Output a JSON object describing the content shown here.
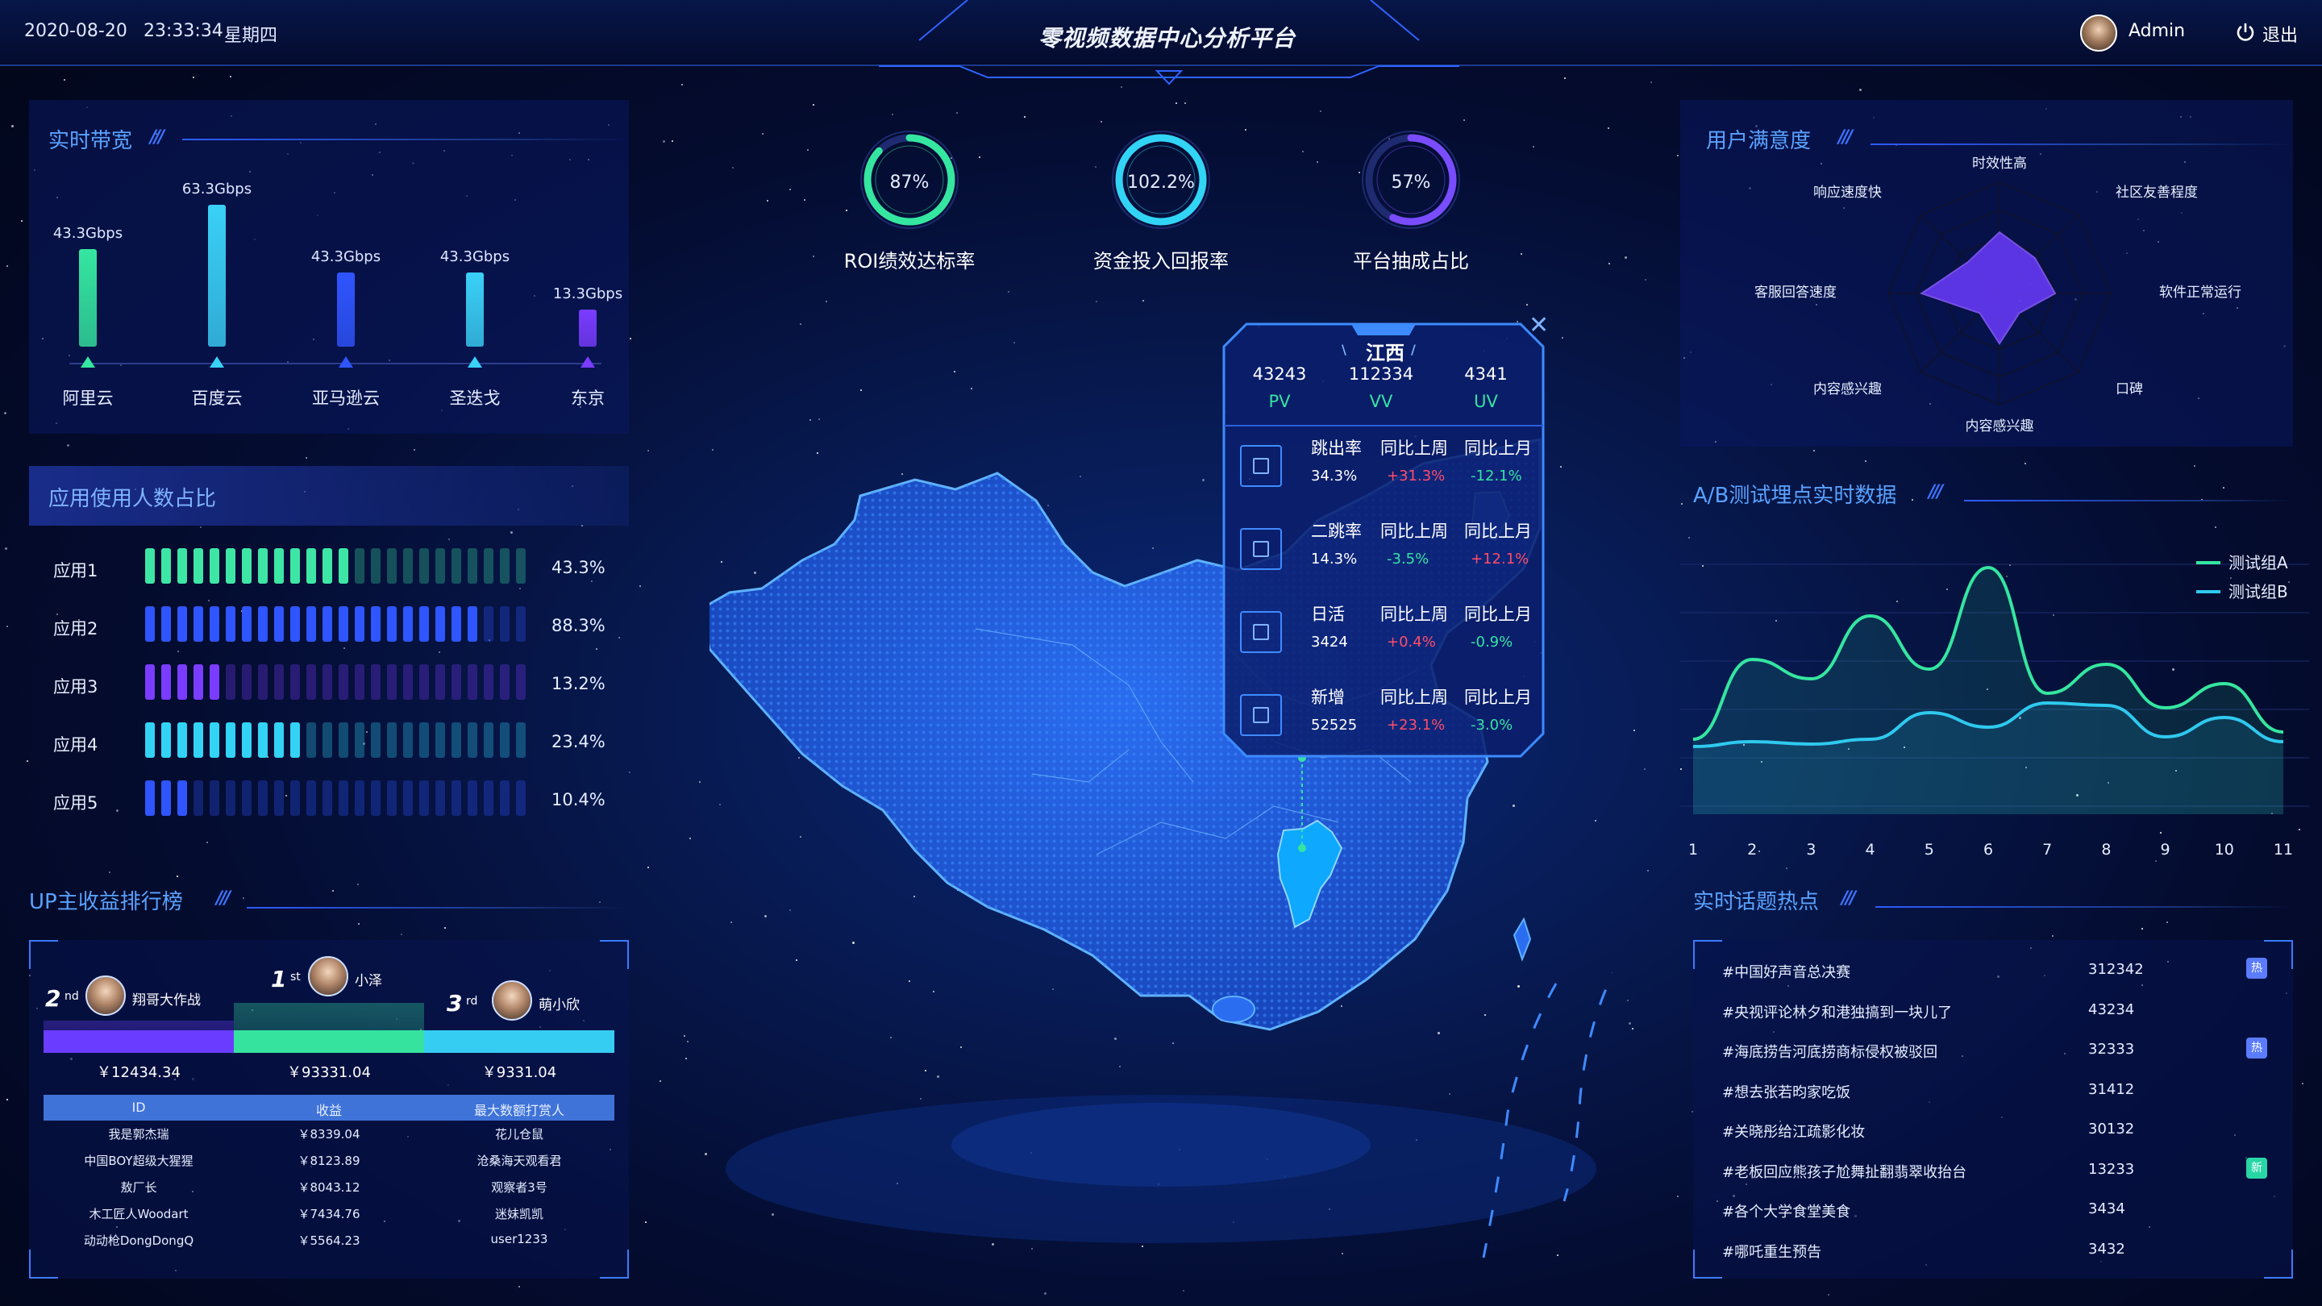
{
  "header": {
    "date": "2020-08-20",
    "time": "23:33:34",
    "weekday": "星期四",
    "title": "零视频数据中心分析平台",
    "user": "Admin",
    "logout": "退出"
  },
  "bandwidth": {
    "title": "实时带宽",
    "items": [
      {
        "label": "阿里云",
        "value": "43.3Gbps",
        "level": 0.69,
        "color": "#35e6a0"
      },
      {
        "label": "百度云",
        "value": "63.3Gbps",
        "level": 1.0,
        "color": "#3ad1f7"
      },
      {
        "label": "亚马逊云",
        "value": "43.3Gbps",
        "level": 0.52,
        "color": "#2f55ff"
      },
      {
        "label": "圣迭戈",
        "value": "43.3Gbps",
        "level": 0.52,
        "color": "#3ad1f7"
      },
      {
        "label": "东京",
        "value": "13.3Gbps",
        "level": 0.26,
        "color": "#7a3cff"
      }
    ]
  },
  "app_usage": {
    "title": "应用使用人数占比",
    "items": [
      {
        "label": "应用1",
        "pct": "43.3%",
        "on": 13,
        "color": "#3ee6a6"
      },
      {
        "label": "应用2",
        "pct": "88.3%",
        "on": 21,
        "color": "#2f55ff"
      },
      {
        "label": "应用3",
        "pct": "13.2%",
        "on": 5,
        "color": "#7a3cff"
      },
      {
        "label": "应用4",
        "pct": "23.4%",
        "on": 10,
        "color": "#33d3f5"
      },
      {
        "label": "应用5",
        "pct": "10.4%",
        "on": 3,
        "color": "#2f55ff"
      }
    ]
  },
  "ranking": {
    "title": "UP主收益排行榜",
    "podium": [
      {
        "rank": "2",
        "suffix": "nd",
        "name": "翔哥大作战",
        "amount": "￥12434.34"
      },
      {
        "rank": "1",
        "suffix": "st",
        "name": "小泽",
        "amount": "￥93331.04"
      },
      {
        "rank": "3",
        "suffix": "rd",
        "name": "萌小欣",
        "amount": "￥9331.04"
      }
    ],
    "headers": [
      "ID",
      "收益",
      "最大数额打赏人"
    ],
    "rows": [
      [
        "我是郭杰瑞",
        "￥8339.04",
        "花儿仓鼠"
      ],
      [
        "中国BOY超级大猩猩",
        "￥8123.89",
        "沧桑海天观看君"
      ],
      [
        "敖厂长",
        "￥8043.12",
        "观察者3号"
      ],
      [
        "木工匠人Woodart",
        "￥7434.76",
        "迷妹凯凯"
      ],
      [
        "动动枪DongDongQ",
        "￥5564.23",
        "user1233"
      ]
    ]
  },
  "kpis": [
    {
      "value": "87%",
      "label": "ROI绩效达标率",
      "fraction": 0.87,
      "color": "#35e6a0"
    },
    {
      "value": "102.2%",
      "label": "资金投入回报率",
      "fraction": 1.0,
      "color": "#32d4f5"
    },
    {
      "value": "57%",
      "label": "平台抽成占比",
      "fraction": 0.57,
      "color": "#7a4cff"
    }
  ],
  "popup": {
    "province": "江西",
    "stats": [
      {
        "value": "43243",
        "label": "PV"
      },
      {
        "value": "112334",
        "label": "VV"
      },
      {
        "value": "4341",
        "label": "UV"
      }
    ],
    "rows": [
      {
        "metric": "跳出率",
        "value": "34.3%",
        "wow": "+31.3%",
        "mom": "-12.1%",
        "wow_up": true,
        "mom_up": false
      },
      {
        "metric": "二跳率",
        "value": "14.3%",
        "wow": "-3.5%",
        "mom": "+12.1%",
        "wow_up": false,
        "mom_up": true
      },
      {
        "metric": "日活",
        "value": "3424",
        "wow": "+0.4%",
        "mom": "-0.9%",
        "wow_up": true,
        "mom_up": false
      },
      {
        "metric": "新增",
        "value": "52525",
        "wow": "+23.1%",
        "mom": "-3.0%",
        "wow_up": true,
        "mom_up": false
      }
    ],
    "wow_label": "同比上周",
    "mom_label": "同比上月"
  },
  "satisfaction": {
    "title": "用户满意度",
    "axes": [
      "时效性高",
      "社区友善程度",
      "软件正常运行",
      "口碑",
      "内容感兴趣",
      "内容感兴趣",
      "客服回答速度",
      "响应速度快"
    ],
    "values": [
      0.55,
      0.45,
      0.5,
      0.25,
      0.45,
      0.25,
      0.7,
      0.4
    ]
  },
  "abtest": {
    "title": "A/B测试埋点实时数据",
    "chart_data": {
      "type": "line",
      "x": [
        1,
        2,
        3,
        4,
        5,
        6,
        7,
        8,
        9,
        10,
        11
      ],
      "series": [
        {
          "name": "测试组A",
          "values": [
            2.1,
            5.4,
            4.6,
            7.2,
            5.0,
            9.2,
            4.0,
            5.2,
            3.4,
            4.4,
            2.4
          ],
          "color": "#35e6a0"
        },
        {
          "name": "测试组B",
          "values": [
            1.8,
            2.0,
            1.9,
            2.1,
            3.2,
            2.6,
            3.6,
            3.5,
            2.2,
            3.0,
            2.0
          ],
          "color": "#2fc9ee"
        }
      ],
      "ylim": [
        0,
        10
      ]
    }
  },
  "topics": {
    "title": "实时话题热点",
    "items": [
      {
        "text": "#中国好声音总决赛",
        "count": "312342",
        "badge": "热",
        "badge_color": "#5b7cff"
      },
      {
        "text": "#央视评论林夕和港独搞到一块儿了",
        "count": "43234",
        "badge": "",
        "badge_color": ""
      },
      {
        "text": "#海底捞告河底捞商标侵权被驳回",
        "count": "32333",
        "badge": "热",
        "badge_color": "#5b7cff"
      },
      {
        "text": "#想去张若昀家吃饭",
        "count": "31412",
        "badge": "",
        "badge_color": ""
      },
      {
        "text": "#关晓彤给江疏影化妆",
        "count": "30132",
        "badge": "",
        "badge_color": ""
      },
      {
        "text": "#老板回应熊孩子尬舞扯翻翡翠收抬台",
        "count": "13233",
        "badge": "新",
        "badge_color": "#28d6a6"
      },
      {
        "text": "#各个大学食堂美食",
        "count": "3434",
        "badge": "",
        "badge_color": ""
      },
      {
        "text": "#哪吒重生预告",
        "count": "3432",
        "badge": "",
        "badge_color": ""
      }
    ]
  }
}
